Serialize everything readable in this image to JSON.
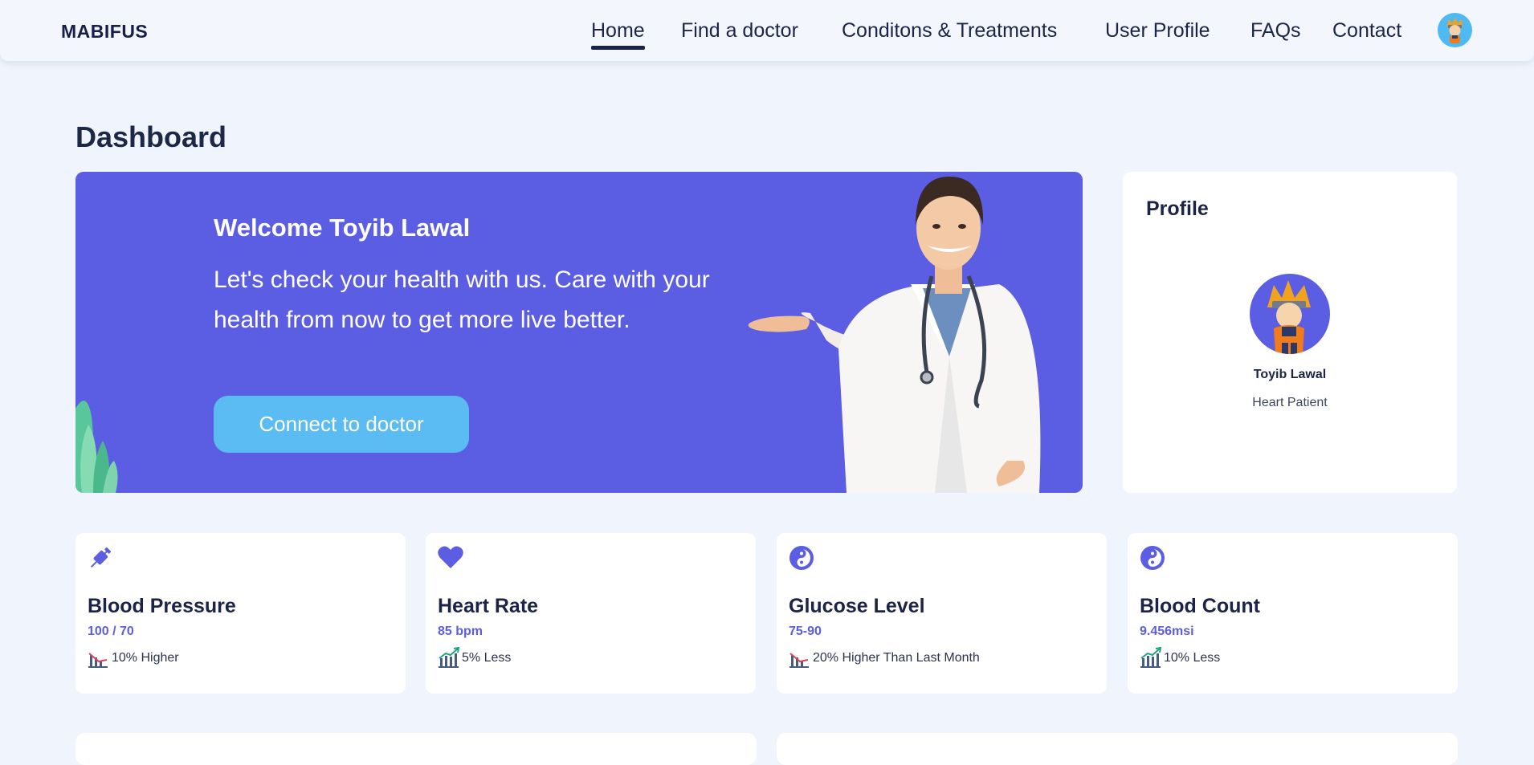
{
  "navbar": {
    "brand": "MABIFUS",
    "links": [
      "Home",
      "Find a doctor",
      "Conditons & Treatments",
      "User Profile",
      "FAQs",
      "Contact"
    ],
    "active": "Home"
  },
  "page": {
    "title": "Dashboard"
  },
  "hero": {
    "title": "Welcome Toyib Lawal",
    "text": "Let's check your health with us. Care with your health from now to get more live better.",
    "button": "Connect to doctor"
  },
  "profile": {
    "heading": "Profile",
    "name": "Toyib Lawal",
    "role": "Heart Patient"
  },
  "stats": [
    {
      "title": "Blood Pressure",
      "value": "100 / 70",
      "trend": "10% Higher",
      "icon": "syringe-icon",
      "direction": "down"
    },
    {
      "title": "Heart Rate",
      "value": "85 bpm",
      "trend": "5% Less",
      "icon": "heart-icon",
      "direction": "up"
    },
    {
      "title": "Glucose Level",
      "value": "75-90",
      "trend": "20% Higher Than Last Month",
      "icon": "yin-yang-icon",
      "direction": "down"
    },
    {
      "title": "Blood Count",
      "value": "9.456msi",
      "trend": "10% Less",
      "icon": "yin-yang-icon",
      "direction": "up"
    }
  ],
  "colors": {
    "accent": "#5b5de3",
    "button": "#5bbcf4",
    "background": "#f0f5fd",
    "text": "#1a2340",
    "trend_up": "#23a37c",
    "trend_down": "#d9435a"
  }
}
